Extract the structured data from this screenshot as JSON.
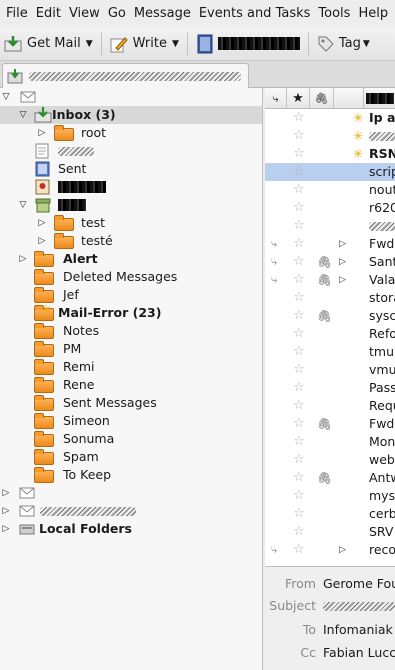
{
  "menu": [
    "File",
    "Edit",
    "View",
    "Go",
    "Message",
    "Events and Tasks",
    "Tools",
    "Help"
  ],
  "toolbar": {
    "get_mail": "Get Mail",
    "write": "Write",
    "tag": "Tag"
  },
  "folders": {
    "inbox": "Inbox (3)",
    "root": "root",
    "sent": "Sent",
    "test": "test",
    "teste": "testé",
    "alert": "Alert",
    "deleted": "Deleted Messages",
    "jef": "Jef",
    "mail_error": "Mail-Error (23)",
    "notes": "Notes",
    "pm": "PM",
    "remi": "Remi",
    "rene": "Rene",
    "sent_messages": "Sent Messages",
    "simeon": "Simeon",
    "sonuma": "Sonuma",
    "spam": "Spam",
    "to_keep": "To Keep",
    "local": "Local Folders"
  },
  "threads": [
    {
      "subject": "Ip a",
      "bold": true,
      "junk": true
    },
    {
      "subject": "",
      "junk": true
    },
    {
      "subject": "RSN",
      "bold": true,
      "junk": true
    },
    {
      "subject": "scrip",
      "selected": true
    },
    {
      "subject": "nout"
    },
    {
      "subject": "r620"
    },
    {
      "subject": ""
    },
    {
      "subject": "Fwd",
      "thread": true,
      "expand": true
    },
    {
      "subject": "Sant",
      "thread": true,
      "attach": true,
      "expand": true
    },
    {
      "subject": "Vala",
      "thread": true,
      "attach": true,
      "expand": true
    },
    {
      "subject": "stora"
    },
    {
      "subject": "sysc",
      "attach": true
    },
    {
      "subject": "Refo"
    },
    {
      "subject": "tmu"
    },
    {
      "subject": "vmu"
    },
    {
      "subject": "Pass"
    },
    {
      "subject": "Requ"
    },
    {
      "subject": "Fwd",
      "attach": true
    },
    {
      "subject": "Mon"
    },
    {
      "subject": "webr"
    },
    {
      "subject": "Antw",
      "attach": true
    },
    {
      "subject": "mys"
    },
    {
      "subject": "cerb"
    },
    {
      "subject": "SRV"
    },
    {
      "subject": "reco",
      "thread": true,
      "expand": true
    }
  ],
  "header": {
    "from_label": "From",
    "from_value": "Gerome Fou",
    "subject_label": "Subject",
    "to_label": "To",
    "to_value": "Infomaniak",
    "cc_label": "Cc",
    "cc_value": "Fabian Lucc"
  }
}
